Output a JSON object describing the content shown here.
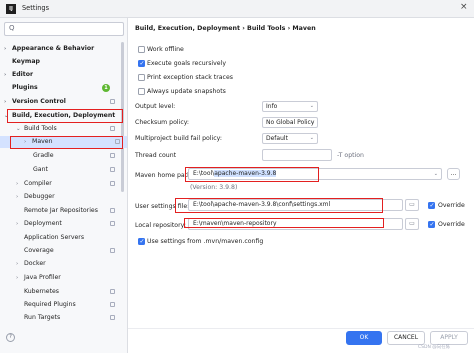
{
  "window": {
    "title": "Settings",
    "app_icon": "IJ"
  },
  "search": {
    "placeholder": "Q"
  },
  "sidebar": {
    "items": [
      {
        "label": "Appearance & Behavior",
        "chevron": "›"
      },
      {
        "label": "Keymap"
      },
      {
        "label": "Editor",
        "chevron": "›"
      },
      {
        "label": "Plugins",
        "badge": "1"
      },
      {
        "label": "Version Control",
        "chevron": "›"
      },
      {
        "label": "Build, Execution, Deployment",
        "chevron": "⌄"
      },
      {
        "label": "Build Tools",
        "chevron": "⌄"
      },
      {
        "label": "Maven",
        "chevron": "›"
      },
      {
        "label": "Gradle"
      },
      {
        "label": "Gant"
      },
      {
        "label": "Compiler",
        "chevron": "›"
      },
      {
        "label": "Debugger",
        "chevron": "›"
      },
      {
        "label": "Remote Jar Repositories"
      },
      {
        "label": "Deployment",
        "chevron": "›"
      },
      {
        "label": "Application Servers"
      },
      {
        "label": "Coverage"
      },
      {
        "label": "Docker",
        "chevron": "›"
      },
      {
        "label": "Java Profiler",
        "chevron": "›"
      },
      {
        "label": "Kubernetes"
      },
      {
        "label": "Required Plugins"
      },
      {
        "label": "Run Targets"
      }
    ]
  },
  "breadcrumb": {
    "parts": [
      "Build, Execution, Deployment",
      "›",
      "Build Tools",
      "›",
      "Maven"
    ]
  },
  "options": {
    "work_offline": "Work offline",
    "execute_goals_recursively": "Execute goals recursively",
    "print_exception_stack_traces": "Print exception stack traces",
    "always_update_snapshots": "Always update snapshots"
  },
  "form": {
    "output_level_label": "Output level:",
    "output_level_value": "Info",
    "checksum_policy_label": "Checksum policy:",
    "checksum_policy_value": "No Global Policy",
    "multiproject_label": "Multiproject build fail policy:",
    "multiproject_value": "Default",
    "thread_count_label": "Thread count",
    "thread_count_hint": "-T option",
    "maven_home_label": "Maven home path:",
    "maven_home_prefix": "E:\\tool\\",
    "maven_home_value": "apache-maven-3.9.8",
    "maven_version": "(Version: 3.9.8)",
    "user_settings_label": "User settings file:",
    "user_settings_value": "E:\\tool\\apache-maven-3.9.8\\conf\\settings.xml",
    "override_label": "Override",
    "local_repo_label": "Local repository:",
    "local_repo_value": "E:\\maven\\maven-repository",
    "override2_label": "Override",
    "use_settings_label": "Use settings from .mvn/maven.config"
  },
  "buttons": {
    "ok": "OK",
    "cancel": "CANCEL",
    "apply": "APPLY",
    "help": "?",
    "browse": "…",
    "folder": "▭"
  },
  "watermark": "CSDN @向在陈"
}
